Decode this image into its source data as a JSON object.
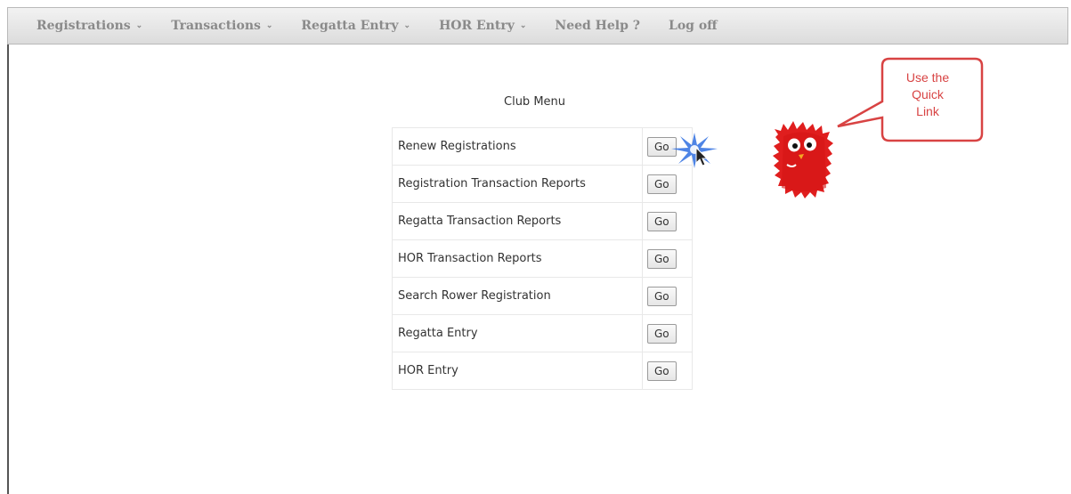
{
  "nav": {
    "items": [
      {
        "label": "Registrations",
        "caret": "⌄"
      },
      {
        "label": "Transactions",
        "caret": "⌄"
      },
      {
        "label": "Regatta Entry",
        "caret": "⌄"
      },
      {
        "label": "HOR Entry",
        "caret": "⌄"
      },
      {
        "label": "Need Help ?"
      },
      {
        "label": "Log off"
      }
    ]
  },
  "main": {
    "title": "Club Menu",
    "rows": [
      {
        "label": "Renew Registrations",
        "button": "Go"
      },
      {
        "label": "Registration Transaction Reports",
        "button": "Go"
      },
      {
        "label": "Regatta Transaction Reports",
        "button": "Go"
      },
      {
        "label": "HOR Transaction Reports",
        "button": "Go"
      },
      {
        "label": "Search Rower Registration",
        "button": "Go"
      },
      {
        "label": "Regatta Entry",
        "button": "Go"
      },
      {
        "label": "HOR Entry",
        "button": "Go"
      }
    ]
  },
  "callout": {
    "lines": [
      "Use the",
      "Quick",
      "Link"
    ],
    "color": "#d84343"
  },
  "mascot": {
    "icon": "red-fuzzy-monster",
    "color": "#e01e1e"
  },
  "annotation": {
    "icon": "click-burst",
    "color": "#2f6fe0"
  }
}
